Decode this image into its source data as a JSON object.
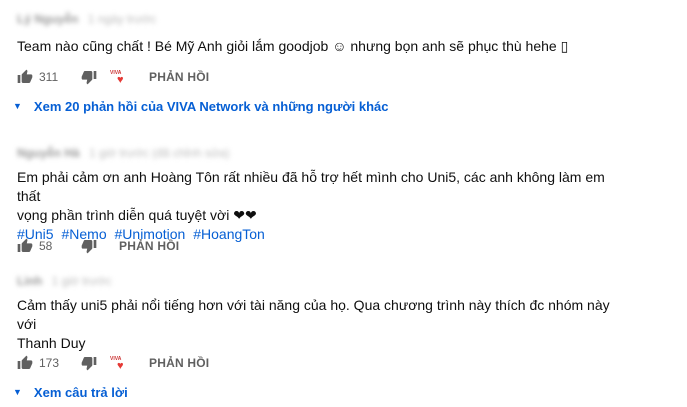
{
  "comments": [
    {
      "author": "Lý Nguyễn",
      "meta": "1 ngày trước",
      "text_lines": [
        "Team nào cũng chất ! Bé Mỹ Anh giỏi lắm goodjob ☺ nhưng bọn anh sẽ phục thù hehe ▯"
      ],
      "hashtags": [],
      "likes": "311",
      "reply_label": "PHẢN HỒI",
      "heart_avatar_text": "VIVA",
      "view_replies": "Xem 20 phản hồi của VIVA Network và những người khác"
    },
    {
      "author": "Nguyễn Hà",
      "meta": "1 giờ trước (đã chỉnh sửa)",
      "text_lines": [
        "Em phải cảm ơn anh Hoàng Tôn rất nhiều đã hỗ trợ hết mình cho Uni5, các anh không làm em thất",
        "vọng phần trình diễn quá tuyệt vời ❤❤"
      ],
      "hashtags": [
        "#Uni5",
        "#Nemo",
        "#Unimotion",
        "#HoangTon"
      ],
      "likes": "58",
      "reply_label": "PHẢN HỒI"
    },
    {
      "author": "Linh",
      "meta": "1 giờ trước",
      "text_lines": [
        "Cảm thấy uni5 phải nổi tiếng hơn với tài năng của họ. Qua chương trình này thích đc nhóm này với",
        "Thanh Duy"
      ],
      "hashtags": [],
      "likes": "173",
      "reply_label": "PHẢN HỒI",
      "heart_avatar_text": "VIVA",
      "view_replies": "Xem câu trả lời"
    }
  ],
  "icons": {
    "like": "thumb-up-icon",
    "dislike": "thumb-down-icon",
    "heart": "creator-heart-icon",
    "expand": "chevron-down-icon"
  },
  "colors": {
    "link": "#065fd4",
    "heart": "#e53935",
    "meta": "#606060"
  }
}
